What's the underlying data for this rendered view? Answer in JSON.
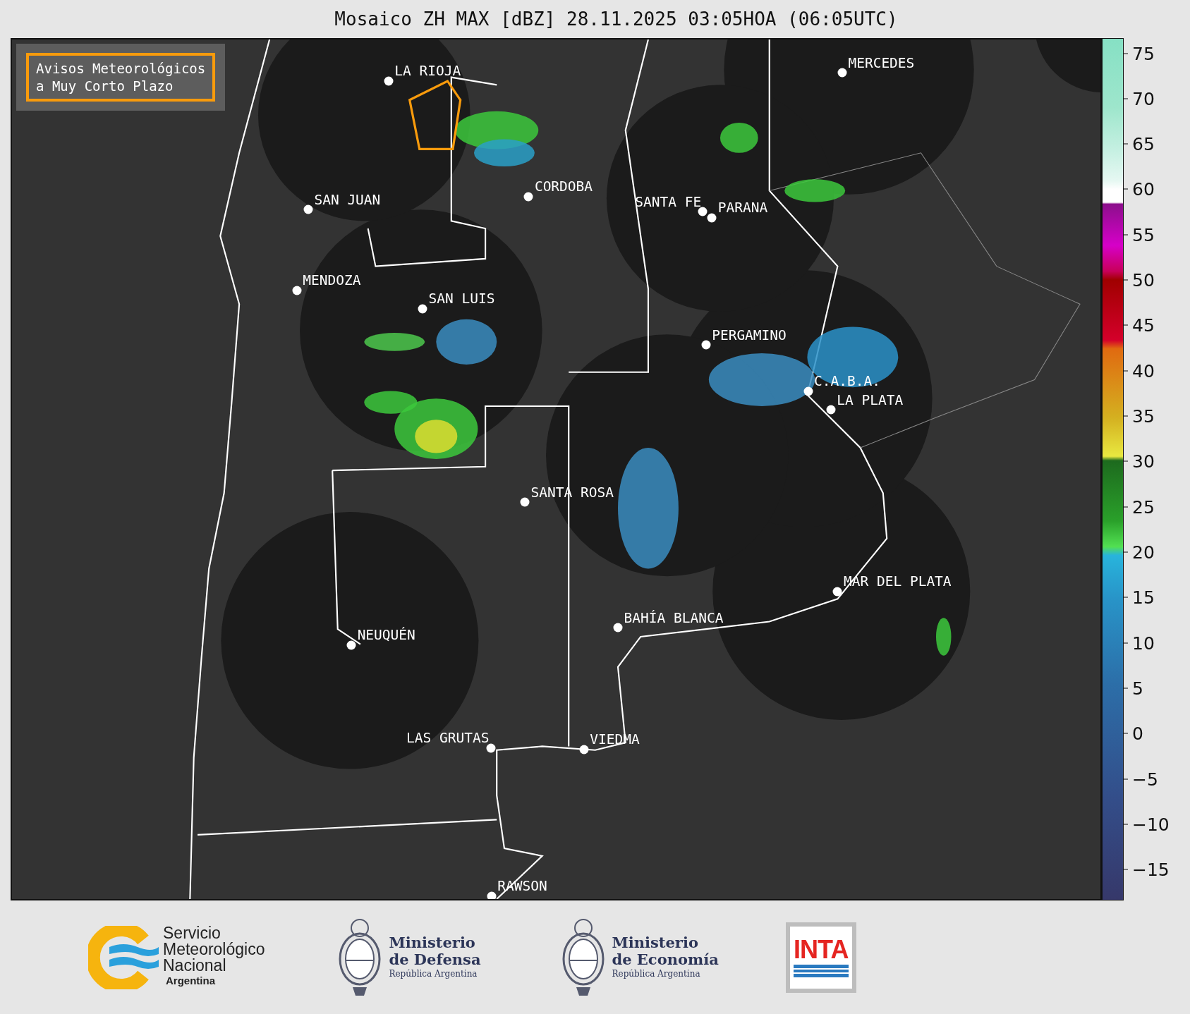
{
  "title": "Mosaico ZH MAX [dBZ] 28.11.2025 03:05HOA (06:05UTC)",
  "legend_box": {
    "text": "Avisos Meteorológicos\na Muy Corto Plazo"
  },
  "cities": [
    {
      "name": "LA RIOJA"
    },
    {
      "name": "MERCEDES"
    },
    {
      "name": "CORDOBA"
    },
    {
      "name": "SAN JUAN"
    },
    {
      "name": "SANTA FE"
    },
    {
      "name": "PARANA"
    },
    {
      "name": "MENDOZA"
    },
    {
      "name": "SAN LUIS"
    },
    {
      "name": "PERGAMINO"
    },
    {
      "name": "C.A.B.A."
    },
    {
      "name": "LA PLATA"
    },
    {
      "name": "SANTA ROSA"
    },
    {
      "name": "MAR DEL PLATA"
    },
    {
      "name": "BAHÍA BLANCA"
    },
    {
      "name": "NEUQUÉN"
    },
    {
      "name": "LAS GRUTAS"
    },
    {
      "name": "VIEDMA"
    },
    {
      "name": "RAWSON"
    }
  ],
  "colorbar": {
    "ticks": [
      "75",
      "70",
      "65",
      "60",
      "55",
      "50",
      "45",
      "40",
      "35",
      "30",
      "25",
      "20",
      "15",
      "10",
      "5",
      "0",
      "−5",
      "−10",
      "−15"
    ]
  },
  "footer": {
    "logos": [
      {
        "kind": "smn",
        "text": "Servicio\nMeteorológico\nNacional",
        "subtitle": "Argentina"
      },
      {
        "kind": "ministry",
        "text": "Ministerio\nde Defensa",
        "subtitle": "República Argentina"
      },
      {
        "kind": "ministry",
        "text": "Ministerio\nde Economía",
        "subtitle": "República Argentina"
      },
      {
        "kind": "inta",
        "text": "INTA"
      }
    ]
  }
}
